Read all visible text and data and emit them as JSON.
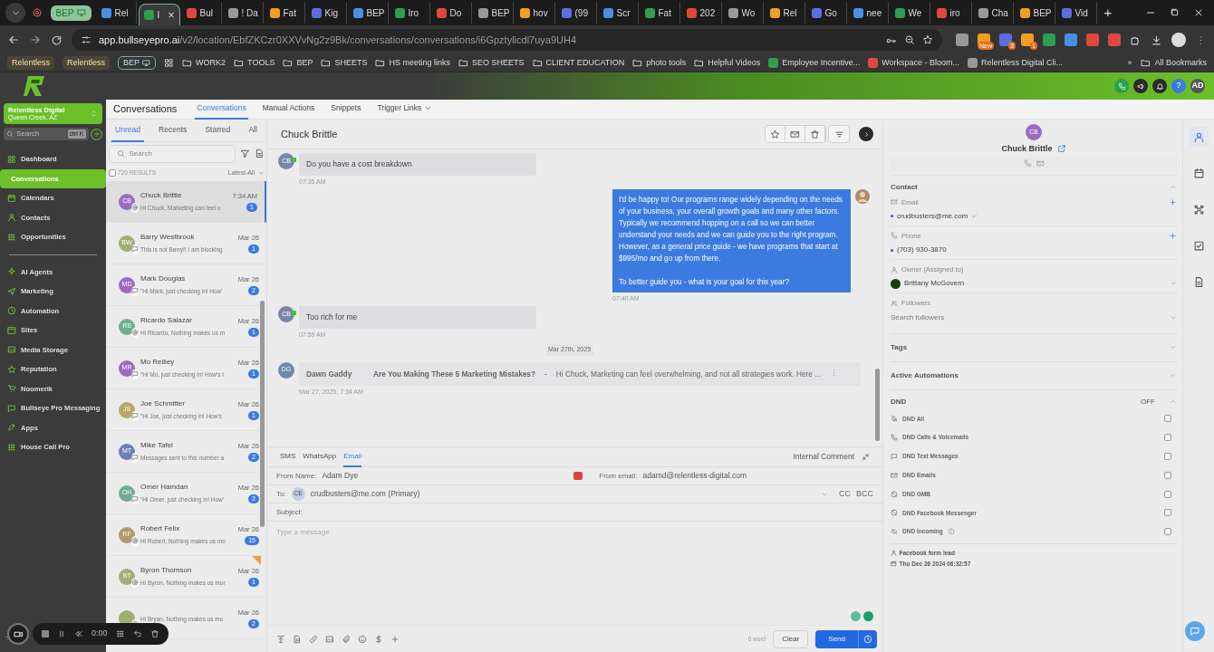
{
  "browser": {
    "tab_group": {
      "label": "BEP"
    },
    "tabs": [
      {
        "label": "Rel",
        "selected": false
      },
      {
        "label": "I",
        "selected": true,
        "close": "×"
      },
      {
        "label": "Bul",
        "selected": false
      },
      {
        "label": "! Da",
        "selected": false
      },
      {
        "label": "Fat",
        "selected": false
      },
      {
        "label": "Kig",
        "selected": false
      },
      {
        "label": "BEP",
        "selected": false
      },
      {
        "label": "Iro",
        "selected": false
      },
      {
        "label": "Do",
        "selected": false
      },
      {
        "label": "BEP",
        "selected": false
      },
      {
        "label": "hov",
        "selected": false
      },
      {
        "label": "(99",
        "selected": false
      },
      {
        "label": "Scr",
        "selected": false
      },
      {
        "label": "Fat",
        "selected": false
      },
      {
        "label": "202",
        "selected": false
      },
      {
        "label": "Wo",
        "selected": false
      },
      {
        "label": "Rel",
        "selected": false
      },
      {
        "label": "Go",
        "selected": false
      },
      {
        "label": "nee",
        "selected": false
      },
      {
        "label": "We",
        "selected": false
      },
      {
        "label": "iro",
        "selected": false
      },
      {
        "label": "Cha",
        "selected": false
      },
      {
        "label": "BEP",
        "selected": false
      },
      {
        "label": "Vid",
        "selected": false
      }
    ],
    "new_tab": "+",
    "address": {
      "host": "app.bullseyepro.ai",
      "path": "/v2/location/EbfZKCzr0XXVvNg2z9Bk/conversations/conversations/i6Gpztylicdl7uya9UH4"
    },
    "extension_badges": [
      "New",
      "3",
      "1"
    ],
    "bookmarks": [
      {
        "kind": "chip",
        "label": "Relentless"
      },
      {
        "kind": "chip",
        "label": "Relentless"
      },
      {
        "kind": "group",
        "label": "BEP"
      },
      {
        "kind": "apps"
      },
      {
        "kind": "folder",
        "label": "WORK2"
      },
      {
        "kind": "folder",
        "label": "TOOLS"
      },
      {
        "kind": "folder",
        "label": "BEP"
      },
      {
        "kind": "folder",
        "label": "SHEETS"
      },
      {
        "kind": "folder",
        "label": "HS meeting links"
      },
      {
        "kind": "folder",
        "label": "SEO SHEETS"
      },
      {
        "kind": "folder",
        "label": "CLIENT EDUCATION"
      },
      {
        "kind": "folder",
        "label": "photo tools"
      },
      {
        "kind": "folder",
        "label": "Helpful Videos"
      },
      {
        "kind": "page",
        "label": "Employee Incentive..."
      },
      {
        "kind": "page",
        "label": "Workspace - Bloom..."
      },
      {
        "kind": "page",
        "label": "Relentless Digital Cli..."
      }
    ],
    "more": "»",
    "all_bookmarks": "All Bookmarks"
  },
  "app_header": {
    "help": "?",
    "user_initials": "AD"
  },
  "sidebar": {
    "account": {
      "name": "Relentless Digital",
      "location": "Queen Creek, AZ"
    },
    "search": {
      "placeholder": "Search",
      "shortcut": "ctrl K"
    },
    "groups": [
      [
        {
          "label": "Dashboard",
          "selected": false
        },
        {
          "label": "Conversations",
          "selected": true
        },
        {
          "label": "Calendars",
          "selected": false
        },
        {
          "label": "Contacts",
          "selected": false
        },
        {
          "label": "Opportunities",
          "selected": false
        }
      ],
      [
        {
          "label": "AI Agents",
          "selected": false
        },
        {
          "label": "Marketing",
          "selected": false
        },
        {
          "label": "Automation",
          "selected": false
        },
        {
          "label": "Sites",
          "selected": false
        },
        {
          "label": "Media Storage",
          "selected": false
        },
        {
          "label": "Reputation",
          "selected": false
        },
        {
          "label": "Noomerik",
          "selected": false
        },
        {
          "label": "Bullseye Pro Messaging",
          "selected": false
        },
        {
          "label": "Apps",
          "selected": false
        },
        {
          "label": "House Call Pro",
          "selected": false
        }
      ]
    ]
  },
  "page_header": {
    "title": "Conversations",
    "tabs": [
      {
        "label": "Conversations",
        "selected": true
      },
      {
        "label": "Manual Actions",
        "selected": false
      },
      {
        "label": "Snippets",
        "selected": false
      },
      {
        "label": "Trigger Links",
        "selected": false,
        "dropdown": true
      }
    ]
  },
  "conversations": {
    "tabs": [
      {
        "label": "Unread",
        "selected": true
      },
      {
        "label": "Recents",
        "selected": false
      },
      {
        "label": "Starred",
        "selected": false
      },
      {
        "label": "All",
        "selected": false
      }
    ],
    "search_placeholder": "Search",
    "select_all_checked": false,
    "results": "720 RESULTS",
    "sort": "Latest-All",
    "items": [
      {
        "initials": "CB",
        "color": "#9b6bc4",
        "kind": "email",
        "name": "Chuck Brittle",
        "preview": "Hi Chuck, Marketing can feel o",
        "time": "7:34 AM",
        "count": "1",
        "selected": true
      },
      {
        "initials": "BW",
        "color": "#9fb070",
        "kind": "sms",
        "name": "Barry Westbrook",
        "preview": "This is not Barry!! I am blocking",
        "time": "Mar 26",
        "count": "1",
        "selected": false
      },
      {
        "initials": "MD",
        "color": "#9b6bc4",
        "kind": "sms",
        "name": "Mark Douglas",
        "preview": "\"Hi Mark, just checking in! How'",
        "time": "Mar 26",
        "count": "2",
        "selected": false
      },
      {
        "initials": "RS",
        "color": "#6fae91",
        "kind": "email",
        "name": "Ricardo Salazar",
        "preview": "Hi Ricardo, Nothing makes us m",
        "time": "Mar 26",
        "count": "1",
        "selected": false
      },
      {
        "initials": "MR",
        "color": "#9b6bc4",
        "kind": "sms",
        "name": "Mo Reilley",
        "preview": "\"Hi Mo, just checking in! How's I",
        "time": "Mar 26",
        "count": "1",
        "selected": false
      },
      {
        "initials": "JS",
        "color": "#b6a86a",
        "kind": "sms",
        "name": "Joe Schmitter",
        "preview": "\"Hi Joe, just checking in! How's",
        "time": "Mar 26",
        "count": "1",
        "selected": false
      },
      {
        "initials": "MT",
        "color": "#6f7fb6",
        "kind": "sms",
        "name": "Mike Tafel",
        "preview": "Messages sent to this number a",
        "time": "Mar 26",
        "count": "2",
        "selected": false
      },
      {
        "initials": "OH",
        "color": "#6fae91",
        "kind": "sms",
        "name": "Omer Hamdan",
        "preview": "\"Hi Omer, just checking in! How'",
        "time": "Mar 26",
        "count": "2",
        "selected": false
      },
      {
        "initials": "RF",
        "color": "#b09a6a",
        "kind": "email",
        "name": "Robert Felix",
        "preview": "Hi Robert, Nothing makes us mo",
        "time": "Mar 26",
        "count": "15",
        "selected": false
      },
      {
        "initials": "BT",
        "color": "#9fb070",
        "kind": "email",
        "name": "Byron Thomson",
        "preview": "Hi Byron, Nothing makes us mor",
        "time": "Mar 26",
        "count": "1",
        "selected": false,
        "flag": true
      },
      {
        "kind": "email",
        "preview": "Hi Bryan, Nothing makes us mo",
        "time": "Mar 26",
        "count": "2",
        "selected": false
      }
    ]
  },
  "chat": {
    "title": "Chuck Brittle",
    "messages": [
      {
        "kind": "inbound",
        "initials": "CB",
        "text": "Do you have a cost breakdown",
        "time": "07:35 AM"
      },
      {
        "kind": "outbound",
        "text": "I'd be happy to! Our programs range widely depending on the needs of your business, your overall growth goals and many other factors. Typically we recommend hopping on a call so we can better understand your needs and we can guide you to the right program. However, as a general price guide - we have programs that start at $995/mo and go up from there.\n\nTo better guide you - what is your goal for this year?",
        "time": "07:40 AM"
      },
      {
        "kind": "inbound",
        "initials": "CB",
        "text": "Too rich for me",
        "time": "07:59 AM"
      },
      {
        "kind": "date",
        "text": "Mar 27th, 2025"
      },
      {
        "kind": "email",
        "initials": "DG",
        "sender": "Dawn Gaddy",
        "subject": "Are You Making These 5 Marketing Mistakes?",
        "separator": "-",
        "snippet": "Hi Chuck, Marketing can feel overwhelming, and not all strategies work. Here ...",
        "time": "Mar 27, 2025, 7:34 AM"
      }
    ]
  },
  "composer": {
    "channels": [
      {
        "label": "SMS",
        "selected": false
      },
      {
        "label": "WhatsApp",
        "selected": false
      },
      {
        "label": "Email",
        "selected": true
      }
    ],
    "internal_comment": "Internal Comment",
    "from_name": {
      "label": "From Name:",
      "value": "Adam Dye"
    },
    "from_email": {
      "label": "From email:",
      "value": "adamd@relentless-digital.com"
    },
    "to": {
      "label": "To:",
      "initials": "CE",
      "value": "crudbusters@me.com (Primary)"
    },
    "cc": "CC",
    "bcc": "BCC",
    "subject_label": "Subject:",
    "placeholder": "Type a message",
    "word_count": "0 word",
    "clear": "Clear",
    "send": "Send"
  },
  "contact_panel": {
    "initials": "CB",
    "name": "Chuck Brittle",
    "contact": {
      "title": "Contact",
      "expanded": true,
      "email_label": "Email",
      "email": "crudbusters@me.com",
      "phone_label": "Phone",
      "phone": "(703) 930-3870",
      "owner_label": "Owner (Assigned to)",
      "owner": "Brittany McGovern",
      "followers_label": "Followers",
      "followers_placeholder": "Search followers"
    },
    "sections": [
      {
        "title": "Tags",
        "expanded": false
      },
      {
        "title": "Active Automations",
        "expanded": false
      }
    ],
    "dnd": {
      "title": "DND",
      "status": "OFF",
      "expanded": true,
      "items": [
        {
          "label": "DND All",
          "checked": false
        },
        {
          "label": "DND Calls & Voicemails",
          "checked": false
        },
        {
          "label": "DND Text Messages",
          "checked": false
        },
        {
          "label": "DND Emails",
          "checked": false
        },
        {
          "label": "DND GMB",
          "checked": false
        },
        {
          "label": "DND Facebook Messenger",
          "checked": false
        },
        {
          "label": "DND Incoming",
          "checked": false,
          "info": true
        }
      ]
    },
    "source": "Facebook form lead",
    "created": "Thu Dec 26 2024 06:32:57"
  },
  "rail": [
    {
      "selected": true
    },
    {
      "selected": false
    },
    {
      "selected": false
    },
    {
      "selected": false
    },
    {
      "selected": false
    }
  ],
  "recorder": {
    "time": "0:00"
  }
}
